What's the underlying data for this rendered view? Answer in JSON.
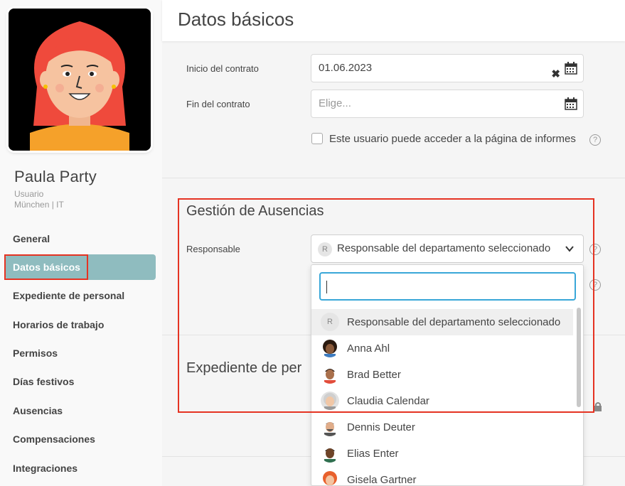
{
  "profile": {
    "name": "Paula Party",
    "role": "Usuario",
    "location": "München | IT"
  },
  "sidebar": {
    "items": [
      {
        "label": "General"
      },
      {
        "label": "Datos básicos",
        "active": true
      },
      {
        "label": "Expediente de personal"
      },
      {
        "label": "Horarios de trabajo"
      },
      {
        "label": "Permisos"
      },
      {
        "label": "Días festivos"
      },
      {
        "label": "Ausencias"
      },
      {
        "label": "Compensaciones"
      },
      {
        "label": "Integraciones"
      }
    ]
  },
  "header": {
    "title": "Datos básicos"
  },
  "contract": {
    "start_label": "Inicio del contrato",
    "start_value": "01.06.2023",
    "end_label": "Fin del contrato",
    "end_placeholder": "Elige...",
    "reports_checkbox_label": "Este usuario puede acceder a la página de informes",
    "reports_checked": false
  },
  "absences": {
    "title": "Gestión de Ausencias",
    "responsible_label": "Responsable",
    "responsible_badge": "R",
    "responsible_value": "Responsable del departamento seleccionado"
  },
  "dropdown": {
    "search_value": "",
    "options": [
      {
        "label": "Responsable del departamento seleccionado",
        "avatar": "R",
        "highlighted": true
      },
      {
        "label": "Anna Ahl",
        "avatar": "anna-avatar"
      },
      {
        "label": "Brad Better",
        "avatar": "brad-avatar"
      },
      {
        "label": "Claudia Calendar",
        "avatar": "claudia-avatar"
      },
      {
        "label": "Dennis Deuter",
        "avatar": "dennis-avatar"
      },
      {
        "label": "Elias Enter",
        "avatar": "elias-avatar"
      },
      {
        "label": "Gisela Gartner",
        "avatar": "gisela-avatar"
      }
    ]
  },
  "personnel_file": {
    "title": "Expediente de per"
  },
  "colors": {
    "accent": "#8fbcbf",
    "highlight_red": "#e53322",
    "focus_blue": "#39a7d8"
  }
}
